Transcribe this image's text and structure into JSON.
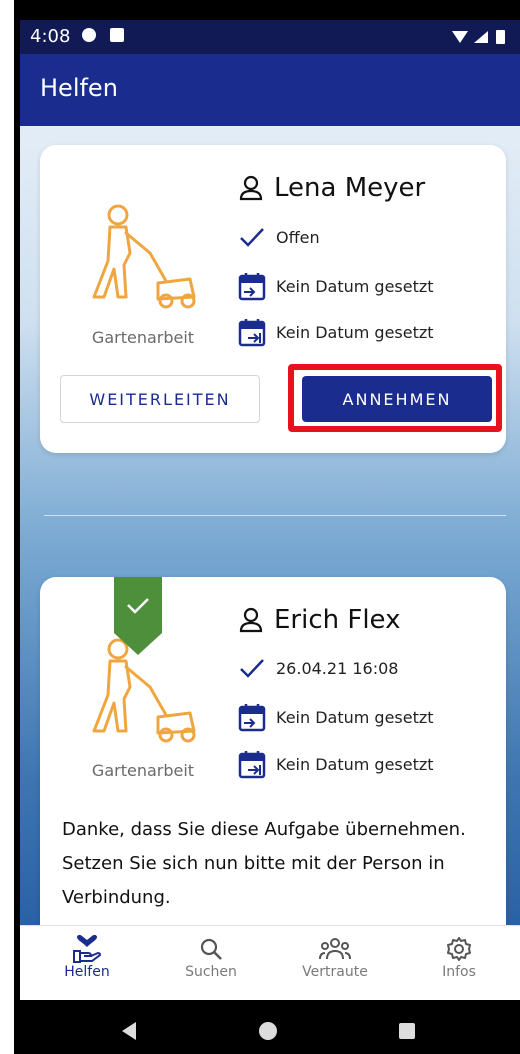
{
  "status": {
    "time": "4:08"
  },
  "appbar": {
    "title": "Helfen"
  },
  "cards": [
    {
      "category": "Gartenarbeit",
      "person": "Lena Meyer",
      "status": "Offen",
      "date1": "Kein Datum gesetzt",
      "date2": "Kein Datum gesetzt",
      "forward_label": "WEITERLEITEN",
      "accept_label": "ANNEHMEN"
    },
    {
      "category": "Gartenarbeit",
      "person": "Erich Flex",
      "status": "26.04.21 16:08",
      "date1": "Kein Datum gesetzt",
      "date2": "Kein Datum gesetzt",
      "message": "Danke, dass Sie diese Aufgabe übernehmen. Setzen Sie sich nun bitte mit der Person in Verbindung."
    }
  ],
  "bottom_nav": [
    {
      "label": "Helfen",
      "icon": "helping-hand-heart-icon",
      "active": true
    },
    {
      "label": "Suchen",
      "icon": "search-icon",
      "active": false
    },
    {
      "label": "Vertraute",
      "icon": "group-icon",
      "active": false
    },
    {
      "label": "Infos",
      "icon": "gear-icon",
      "active": false
    }
  ],
  "colors": {
    "primary": "#1b2c8f",
    "accent_orange": "#f0a640",
    "check_green": "#4d8f3a",
    "highlight_red": "#e8111d"
  }
}
